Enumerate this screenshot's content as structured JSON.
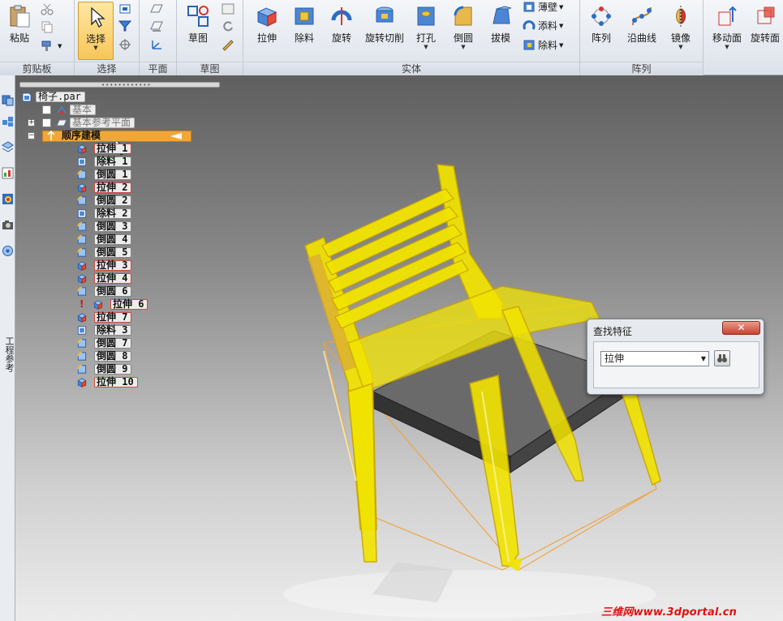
{
  "ribbon": {
    "clipboard": {
      "paste_label": "粘贴",
      "group_label": "剪贴板"
    },
    "select": {
      "select_label": "选择",
      "group_label": "选择"
    },
    "plane": {
      "group_label": "平面"
    },
    "sketch": {
      "sketch_label": "草图",
      "group_label": "草图"
    },
    "solid": {
      "group_label": "实体",
      "buttons": [
        "拉伸",
        "除料",
        "旋转",
        "旋转切削",
        "打孔",
        "倒圆",
        "拔模"
      ],
      "small": [
        "薄壁",
        "添料",
        "除料"
      ]
    },
    "pattern": {
      "group_label": "阵列",
      "buttons": [
        "阵列",
        "沿曲线",
        "镜像"
      ]
    },
    "face": {
      "buttons": [
        "移动面",
        "旋转面"
      ]
    }
  },
  "leftstrip": {
    "vertical_text": "工程参考"
  },
  "tree": {
    "root": "椅子.par",
    "base": "基本",
    "base_planes": "基本参考平面",
    "ordered": "顺序建模",
    "features": [
      {
        "name": "拉伸 1",
        "kind": "extrude"
      },
      {
        "name": "除料 1",
        "kind": "cutout"
      },
      {
        "name": "倒圆 1",
        "kind": "round"
      },
      {
        "name": "拉伸 2",
        "kind": "extrude"
      },
      {
        "name": "倒圆 2",
        "kind": "round"
      },
      {
        "name": "除料 2",
        "kind": "cutout"
      },
      {
        "name": "倒圆 3",
        "kind": "round"
      },
      {
        "name": "倒圆 4",
        "kind": "round"
      },
      {
        "name": "倒圆 5",
        "kind": "round"
      },
      {
        "name": "拉伸 3",
        "kind": "extrude"
      },
      {
        "name": "拉伸 4",
        "kind": "extrude"
      },
      {
        "name": "倒圆 6",
        "kind": "round"
      },
      {
        "name": "拉伸 6",
        "kind": "extrude"
      },
      {
        "name": "拉伸 7",
        "kind": "extrude"
      },
      {
        "name": "除料 3",
        "kind": "cutout"
      },
      {
        "name": "倒圆 7",
        "kind": "round"
      },
      {
        "name": "倒圆 8",
        "kind": "round"
      },
      {
        "name": "倒圆 9",
        "kind": "round"
      },
      {
        "name": "拉伸 10",
        "kind": "extrude"
      }
    ],
    "warning_mark": "!"
  },
  "dialog": {
    "title": "查找特征",
    "close_label": "✕",
    "selected": "拉伸"
  },
  "watermark": "三维网www.3dportal.cn",
  "colors": {
    "highlight_yellow": "#f2e400",
    "accent_orange": "#f5a623",
    "tree_selected": "#f0a73a"
  }
}
